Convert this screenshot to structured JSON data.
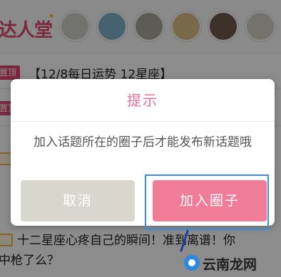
{
  "header": {
    "logo_text": "达人堂",
    "avatar_colors": [
      "#cfcfc8",
      "#7fb2c9",
      "#a9a79b",
      "#d9c086",
      "#6e5a4f",
      "#d4d0c6"
    ]
  },
  "feed": {
    "items": [
      {
        "badge": "置顶",
        "title": "【12/8每日运势 12星座】"
      },
      {
        "badge": "置顶",
        "title": "",
        "partial": true
      }
    ],
    "bottom_post": {
      "title_line1": "十二星座心疼自己的瞬间！准到离谱！你",
      "title_line2": "中枪了么？"
    }
  },
  "dialog": {
    "title": "提示",
    "message": "加入话题所在的圈子后才能发布新话题哦",
    "cancel_label": "取消",
    "join_label": "加入圈子"
  },
  "watermark": {
    "text": "云南龙网"
  },
  "colors": {
    "accent_pink": "#ea6d94",
    "button_pink": "#f07c98",
    "cancel_gray": "#d9d6ce",
    "focus_blue": "#3b8fd8"
  }
}
